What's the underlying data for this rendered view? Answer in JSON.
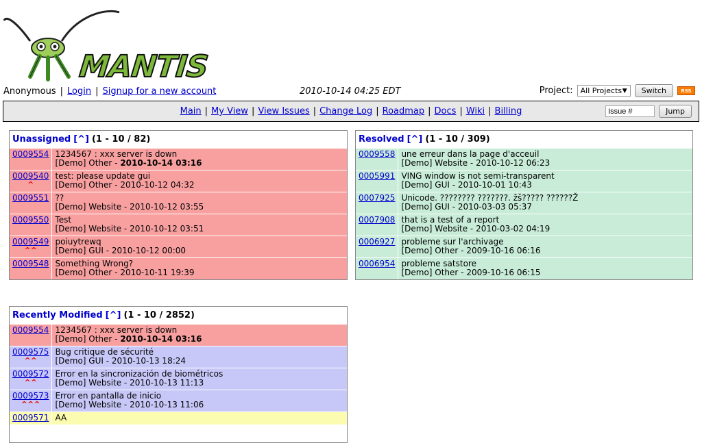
{
  "logo_text": "MANTIS",
  "user_bar": {
    "user": "Anonymous",
    "login": "Login",
    "signup": "Signup for a new account",
    "datetime": "2010-10-14 04:25 EDT"
  },
  "project": {
    "label": "Project:",
    "selected": "All Projects",
    "switch_label": "Switch",
    "rss_label": "RSS"
  },
  "menu": {
    "items": [
      "Main",
      "My View",
      "View Issues",
      "Change Log",
      "Roadmap",
      "Docs",
      "Wiki",
      "Billing"
    ],
    "issue_placeholder": "Issue #",
    "jump_label": "Jump"
  },
  "unassigned": {
    "title": "Unassigned",
    "caret": "[^]",
    "range": "(1 - 10 / 82)",
    "rows": [
      {
        "id": "0009554",
        "summary": "1234567 : xxx server is down",
        "meta": "[Demo] Other - ",
        "date": "2010-10-14 03:16",
        "bold_date": true,
        "priority": ""
      },
      {
        "id": "0009540",
        "summary": "test: please update gui",
        "meta": "[Demo] Other - ",
        "date": "2010-10-12 04:32",
        "bold_date": false,
        "priority": "^"
      },
      {
        "id": "0009551",
        "summary": "??",
        "meta": "[Demo] Website - ",
        "date": "2010-10-12 03:55",
        "bold_date": false,
        "priority": ""
      },
      {
        "id": "0009550",
        "summary": "Test",
        "meta": "[Demo] Website - ",
        "date": "2010-10-12 03:51",
        "bold_date": false,
        "priority": ""
      },
      {
        "id": "0009549",
        "summary": "poiuytrewq",
        "meta": "[Demo] GUI - ",
        "date": "2010-10-12 00:00",
        "bold_date": false,
        "priority": "^^"
      },
      {
        "id": "0009548",
        "summary": "Something Wrong?",
        "meta": "[Demo] Other - ",
        "date": "2010-10-11 19:39",
        "bold_date": false,
        "priority": ""
      }
    ]
  },
  "resolved": {
    "title": "Resolved",
    "caret": "[^]",
    "range": "(1 - 10 / 309)",
    "rows": [
      {
        "id": "0009558",
        "summary": "une erreur dans la page d'acceuil",
        "meta": "[Demo] Website - ",
        "date": "2010-10-12 06:23"
      },
      {
        "id": "0005991",
        "summary": "VING window is not semi-transparent",
        "meta": "[Demo] GUI - ",
        "date": "2010-10-01 10:43"
      },
      {
        "id": "0007925",
        "summary": "Unicode. ???????? ???????. žš????? ??????Ž",
        "meta": "[Demo] GUI - ",
        "date": "2010-03-03 05:37"
      },
      {
        "id": "0007908",
        "summary": "that is a test of a report",
        "meta": "[Demo] Website - ",
        "date": "2010-03-02 04:19"
      },
      {
        "id": "0006927",
        "summary": "probleme sur l'archivage",
        "meta": "[Demo] Other - ",
        "date": "2009-10-16 06:16"
      },
      {
        "id": "0006954",
        "summary": "probleme satstore",
        "meta": "[Demo] Other - ",
        "date": "2009-10-16 06:15"
      }
    ]
  },
  "recent": {
    "title": "Recently Modified",
    "caret": "[^]",
    "range": "(1 - 10 / 2852)",
    "rows": [
      {
        "id": "0009554",
        "summary": "1234567 : xxx server is down",
        "meta": "[Demo] Other - ",
        "date": "2010-10-14 03:16",
        "bold_date": true,
        "priority": "",
        "color": "red"
      },
      {
        "id": "0009575",
        "summary": "Bug critique de sécurité",
        "meta": "[Demo] GUI - ",
        "date": "2010-10-13 18:24",
        "bold_date": false,
        "priority": "^^",
        "color": "blue"
      },
      {
        "id": "0009572",
        "summary": "Error en la sincronización de biométricos",
        "meta": "[Demo] Website - ",
        "date": "2010-10-13 11:13",
        "bold_date": false,
        "priority": "^^",
        "color": "blue"
      },
      {
        "id": "0009573",
        "summary": "Error en pantalla de inicio",
        "meta": "[Demo] Website - ",
        "date": "2010-10-13 11:06",
        "bold_date": false,
        "priority": "^^^",
        "color": "blue"
      },
      {
        "id": "0009571",
        "summary": "AA",
        "meta": "",
        "date": "",
        "bold_date": false,
        "priority": "",
        "color": "yellow"
      }
    ]
  },
  "colors": {
    "red_row": "#f8a0a0",
    "green_row": "#c8ecd8",
    "blue_row": "#c8c8f8",
    "yellow_row": "#fcfcb0",
    "link": "#0000cc"
  }
}
